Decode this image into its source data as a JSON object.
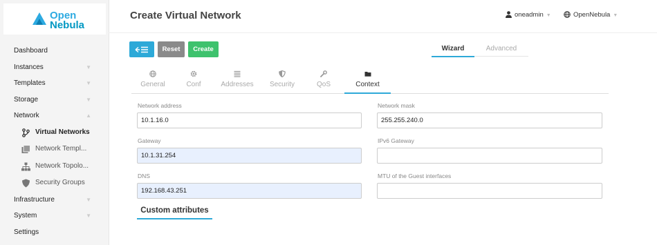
{
  "logo": {
    "line1": "Open",
    "line2": "Nebula"
  },
  "sidebar": {
    "items": [
      {
        "label": "Dashboard"
      },
      {
        "label": "Instances"
      },
      {
        "label": "Templates"
      },
      {
        "label": "Storage"
      },
      {
        "label": "Network"
      },
      {
        "label": "Infrastructure"
      },
      {
        "label": "System"
      },
      {
        "label": "Settings"
      }
    ],
    "network_subitems": [
      {
        "label": "Virtual Networks",
        "icon": "virtual-networks-icon"
      },
      {
        "label": "Network Templ...",
        "icon": "network-templates-icon"
      },
      {
        "label": "Network Topolo...",
        "icon": "network-topology-icon"
      },
      {
        "label": "Security Groups",
        "icon": "shield-icon"
      }
    ]
  },
  "header": {
    "title": "Create Virtual Network",
    "user": "oneadmin",
    "zone": "OpenNebula"
  },
  "toolbar": {
    "reset_label": "Reset",
    "create_label": "Create"
  },
  "mode_tabs": {
    "wizard": "Wizard",
    "advanced": "Advanced"
  },
  "tabs": [
    {
      "label": "General",
      "icon": "globe-icon"
    },
    {
      "label": "Conf",
      "icon": "gear-icon"
    },
    {
      "label": "Addresses",
      "icon": "list-icon"
    },
    {
      "label": "Security",
      "icon": "shield-icon"
    },
    {
      "label": "QoS",
      "icon": "wrench-icon"
    },
    {
      "label": "Context",
      "icon": "folder-icon"
    }
  ],
  "form": {
    "network_address": {
      "label": "Network address",
      "value": "10.1.16.0"
    },
    "network_mask": {
      "label": "Network mask",
      "value": "255.255.240.0"
    },
    "gateway": {
      "label": "Gateway",
      "value": "10.1.31.254"
    },
    "ipv6_gateway": {
      "label": "IPv6 Gateway",
      "value": ""
    },
    "dns": {
      "label": "DNS",
      "value": "192.168.43.251"
    },
    "mtu": {
      "label": "MTU of the Guest interfaces",
      "value": ""
    }
  },
  "custom_attributes": "Custom attributes",
  "colors": {
    "accent": "#2da9d8",
    "reset": "#8a8a8a",
    "create": "#3ec26d",
    "autofill": "#e8f0fe"
  }
}
